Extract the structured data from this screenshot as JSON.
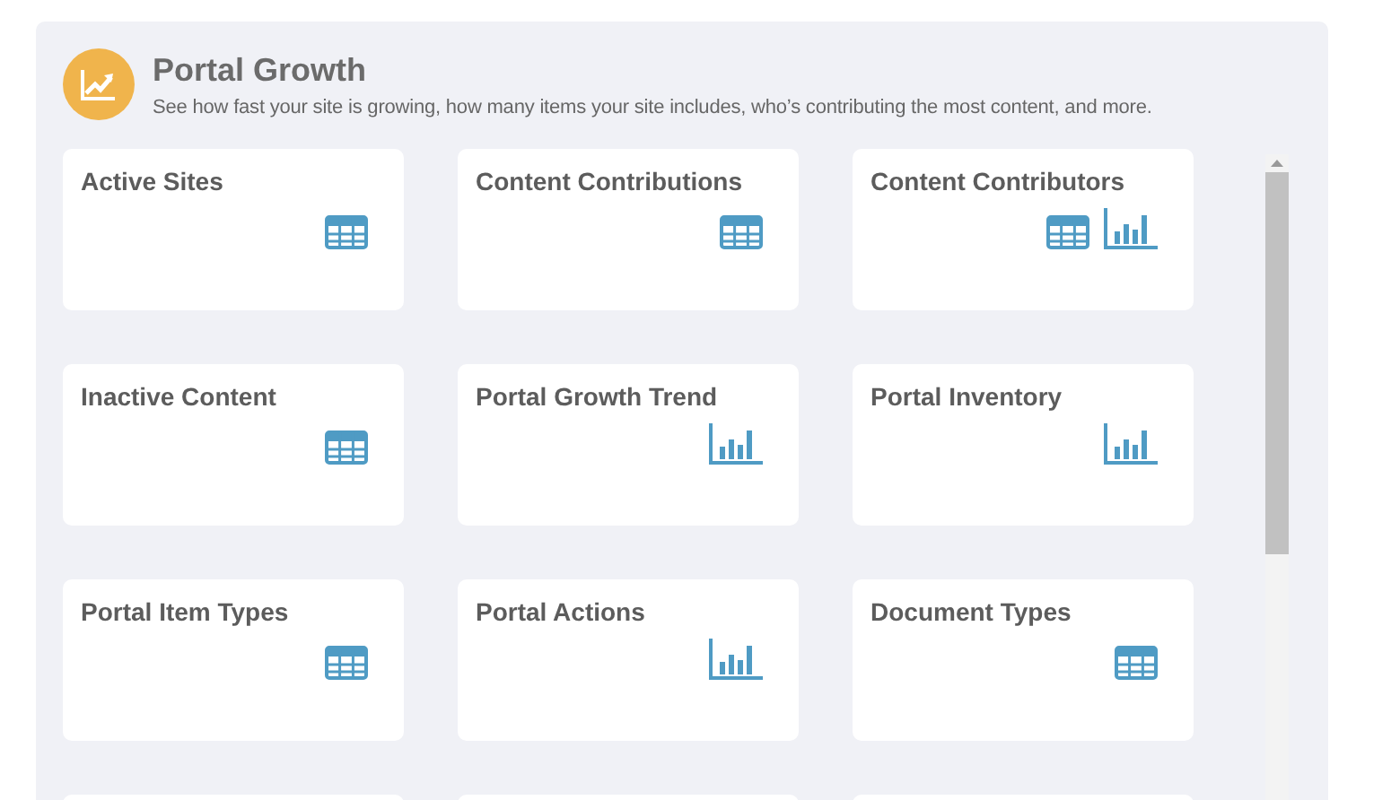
{
  "header": {
    "title": "Portal Growth",
    "subtitle": "See how fast your site is growing, how many items your site includes, who’s contributing the most content, and more."
  },
  "cards": [
    {
      "title": "Active Sites",
      "icons": [
        {
          "kind": "table"
        }
      ]
    },
    {
      "title": "Content Contributions",
      "icons": [
        {
          "kind": "table"
        }
      ]
    },
    {
      "title": "Content Contributors",
      "icons": [
        {
          "kind": "table"
        },
        {
          "kind": "chart"
        }
      ]
    },
    {
      "title": "Inactive Content",
      "icons": [
        {
          "kind": "table"
        }
      ]
    },
    {
      "title": "Portal Growth Trend",
      "icons": [
        {
          "kind": "chart"
        }
      ]
    },
    {
      "title": "Portal Inventory",
      "icons": [
        {
          "kind": "chart"
        }
      ]
    },
    {
      "title": "Portal Item Types",
      "icons": [
        {
          "kind": "table"
        }
      ]
    },
    {
      "title": "Portal Actions",
      "icons": [
        {
          "kind": "chart"
        }
      ]
    },
    {
      "title": "Document Types",
      "icons": [
        {
          "kind": "table"
        }
      ]
    },
    {
      "cut": true
    },
    {
      "cut": true
    },
    {
      "cut": true
    }
  ]
}
